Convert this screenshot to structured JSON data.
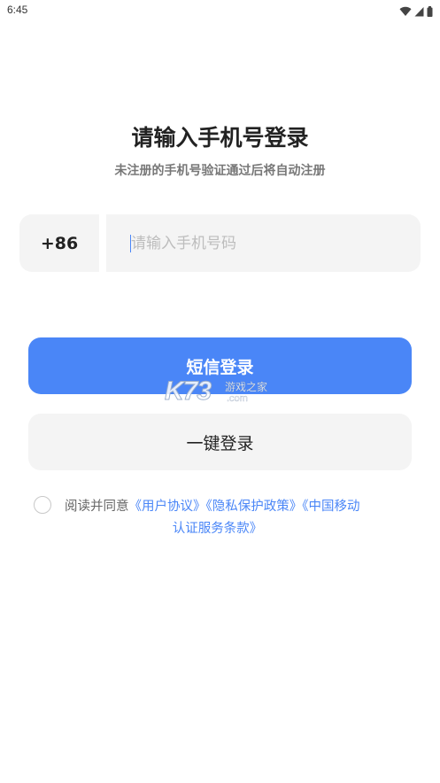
{
  "status_bar": {
    "time": "6:45",
    "icons": [
      "wifi-icon",
      "signal-icon",
      "battery-icon"
    ]
  },
  "header": {
    "title": "请输入手机号登录",
    "subtitle": "未注册的手机号验证通过后将自动注册"
  },
  "phone": {
    "country_code": "+86",
    "placeholder": "请输入手机号码",
    "value": ""
  },
  "buttons": {
    "sms_login": "短信登录",
    "one_key_login": "一键登录"
  },
  "watermark": {
    "logo": "K73",
    "name": "游戏之家",
    "domain": ".com"
  },
  "agreement": {
    "checked": false,
    "prefix": "阅读并同意",
    "user_agreement": "《用户协议》",
    "privacy_policy": "《隐私保护政策》",
    "cmcc_terms_part1": "《中国移动",
    "cmcc_terms_part2": "认证服务条款》"
  },
  "colors": {
    "accent": "#4a86f7",
    "field_background": "#f4f4f4",
    "title_text": "#222222",
    "subtitle_text": "#777777",
    "placeholder_text": "#bdbdbd"
  }
}
